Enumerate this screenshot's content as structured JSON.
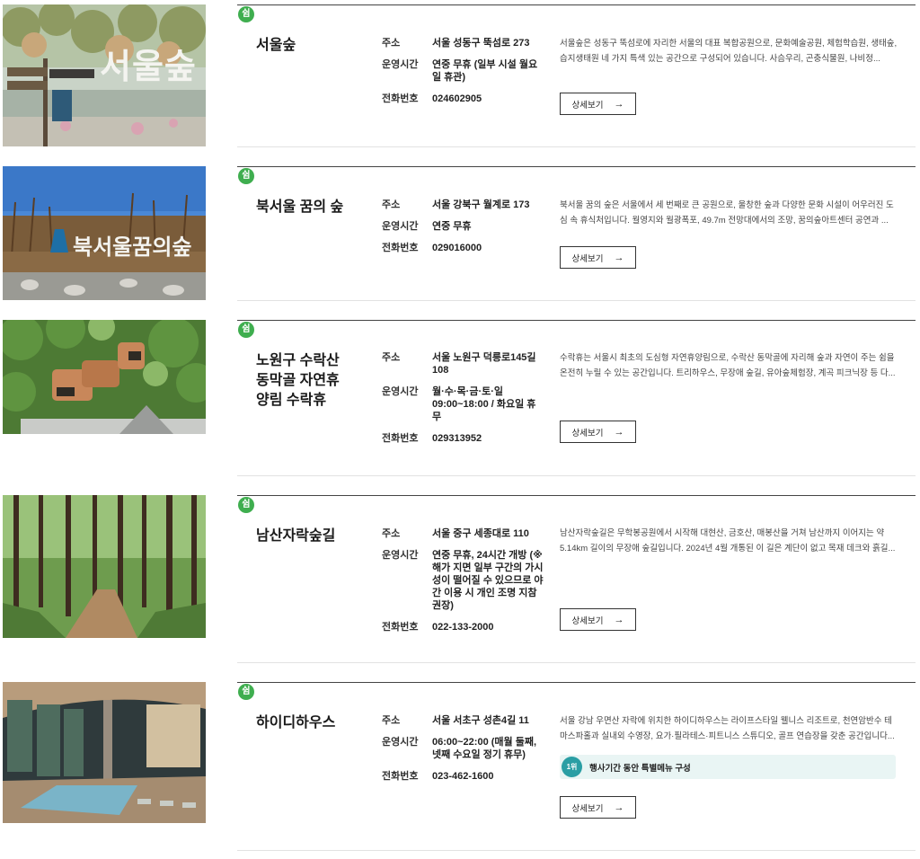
{
  "labels": {
    "address": "주소",
    "hours": "운영시간",
    "phone": "전화번호",
    "detail_button": "상세보기",
    "arrow": "→",
    "badge": "쉼"
  },
  "items": [
    {
      "title": "서울숲",
      "image_text": "서울숲",
      "address": "서울 성동구 뚝섬로 273",
      "hours": "연중 무휴 (일부 시설 월요일 휴관)",
      "phone": "024602905",
      "description": "서울숲은 성동구 뚝섬로에 자리한 서울의 대표 복합공원으로, 문화예술공원, 체험학습원, 생태숲, 습지생태원 네 가지 특색 있는 공간으로 구성되어 있습니다. 사슴우리, 곤충식물원, 나비정..."
    },
    {
      "title": "북서울 꿈의 숲",
      "image_text": "북서울꿈의숲",
      "address": "서울 강북구 월계로 173",
      "hours": "연중 무휴",
      "phone": "029016000",
      "description": "북서울 꿈의 숲은 서울에서 세 번째로 큰 공원으로, 울창한 숲과 다양한 문화 시설이 어우러진 도심 속 휴식처입니다. 월영지와 월광폭포, 49.7m 전망대에서의 조망, 꿈의숲아트센터 공연과 ..."
    },
    {
      "title": "노원구 수락산 동막골 자연휴양림 수락휴",
      "address": "서울 노원구 덕릉로145길 108",
      "hours": "월·수·목·금·토·일 09:00~18:00 / 화요일 휴무",
      "phone": "029313952",
      "description": "수락휴는 서울시 최초의 도심형 자연휴양림으로, 수락산 동막골에 자리해 숲과 자연이 주는 쉼을 온전히 누릴 수 있는 공간입니다. 트리하우스, 무장애 숲길, 유아숲체험장, 계곡 피크닉장 등 다..."
    },
    {
      "title": "남산자락숲길",
      "address": "서울 중구 세종대로 110",
      "hours": "연중 무휴, 24시간 개방 (※해가 지면 일부 구간의 가시성이 떨어질 수 있으므로 야간 이용 시 개인 조명 지참 권장)",
      "phone": "022-133-2000",
      "description": "남산자락숲길은 무학봉공원에서 시작해 대현산, 금호산, 매봉산을 거쳐 남산까지 이어지는 약 5.14km 길이의 무장애 숲길입니다. 2024년 4월 개통된 이 길은 계단이 없고 목재 데크와 흙길..."
    },
    {
      "title": "하이디하우스",
      "address": "서울 서초구 성촌4길 11",
      "hours": "06:00~22:00 (매월 둘째, 넷째 수요일 정기 휴무)",
      "phone": "023-462-1600",
      "description": "서울 강남 우면산 자락에 위치한 하이디하우스는 라이프스타일 웰니스 리조트로, 천연암반수 테마스파홀과 실내외 수영장, 요가·필라테스·피트니스 스튜디오, 골프 연습장을 갖춘 공간입니다...",
      "promo_icon": "1위",
      "promo": "행사기간 동안 특별메뉴 구성"
    }
  ],
  "colors": {
    "badge": "#3fae4f",
    "promo_bg": "#e9f5f4",
    "promo_icon": "#2a9ea4"
  }
}
